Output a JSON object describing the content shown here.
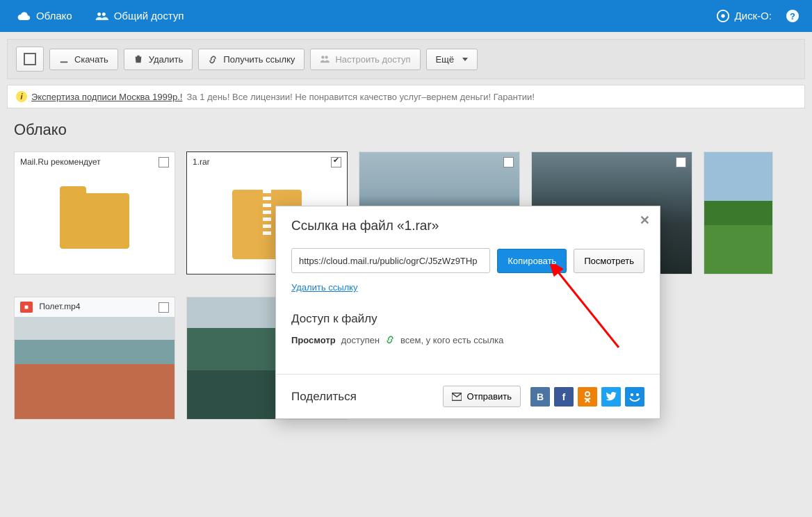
{
  "nav": {
    "cloud": "Облако",
    "shared": "Общий доступ",
    "disko": "Диск-О:"
  },
  "toolbar": {
    "download": "Скачать",
    "delete": "Удалить",
    "get_link": "Получить ссылку",
    "access": "Настроить доступ",
    "more": "Ещё"
  },
  "ad": {
    "link": "Экспертиза подписи Москва 1999р.!",
    "rest": "За 1 день! Все лицензии! Не понравится качество услуг–вернем деньги! Гарантии!"
  },
  "breadcrumb": "Облако",
  "tiles": [
    {
      "label": "Mail.Ru рекомендует",
      "kind": "folder",
      "checked": false
    },
    {
      "label": "1.rar",
      "kind": "zip",
      "checked": true
    },
    {
      "label": "",
      "kind": "mtn1",
      "checked": false
    },
    {
      "label": "",
      "kind": "mtn2",
      "checked": false
    },
    {
      "label": "",
      "kind": "green",
      "checked": false,
      "cut": true
    },
    {
      "label": "Полет.mp4",
      "kind": "video",
      "checked": false
    },
    {
      "label": "",
      "kind": "lake",
      "checked": false
    }
  ],
  "modal": {
    "title": "Ссылка на файл «1.rar»",
    "url": "https://cloud.mail.ru/public/ogrC/J5zWz9THp",
    "copy": "Копировать",
    "view": "Посмотреть",
    "delete_link": "Удалить ссылку",
    "access_title": "Доступ к файлу",
    "access_strong": "Просмотр",
    "access_light": "доступен",
    "access_who": "всем, у кого есть ссылка",
    "share_label": "Поделиться",
    "send": "Отправить"
  },
  "social": {
    "vk": "B",
    "fb": "f",
    "ok": "OK",
    "tw": "t",
    "mm": "@"
  }
}
